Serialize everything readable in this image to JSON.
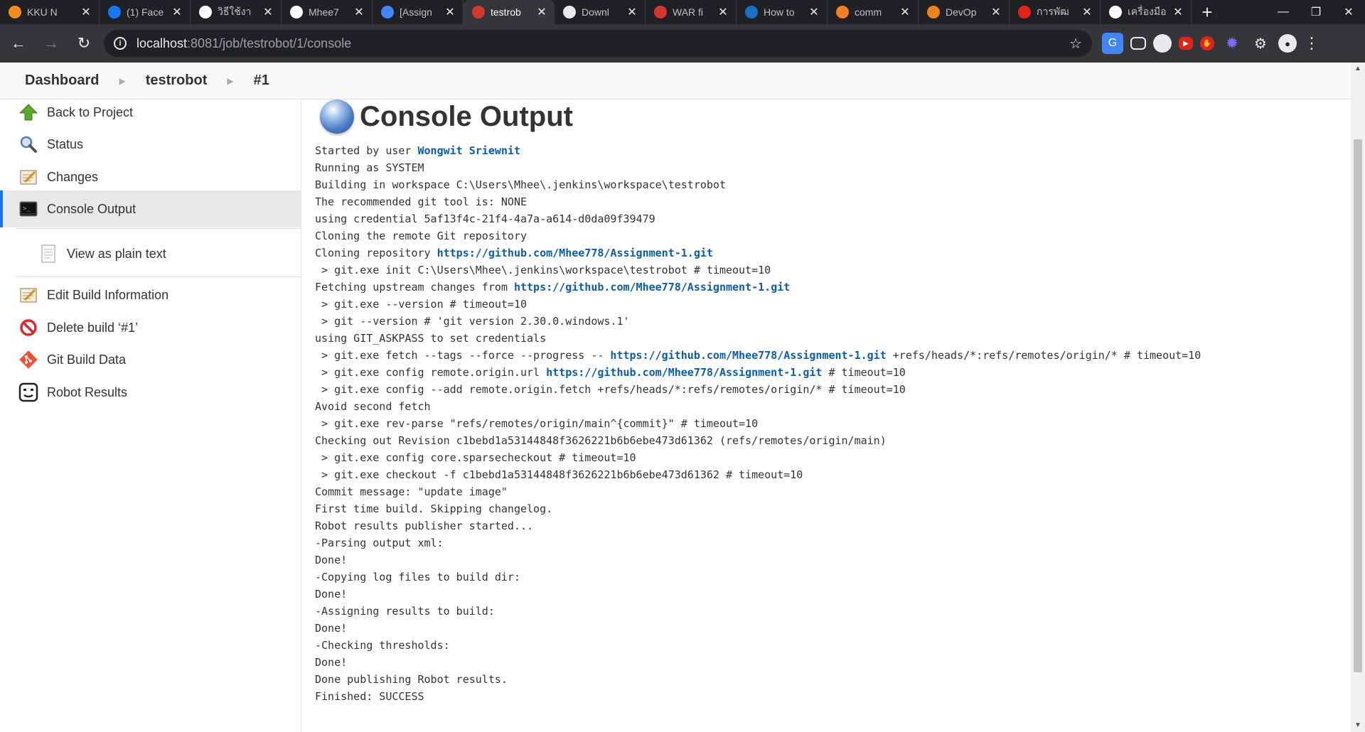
{
  "browser": {
    "tabs": [
      {
        "title": "KKU N",
        "icon": "kku-icon",
        "color": "#f28b22"
      },
      {
        "title": "(1) Face",
        "icon": "facebook-icon",
        "color": "#1877f2"
      },
      {
        "title": "วิธีใช้งา",
        "icon": "github-icon",
        "color": "#ffffff"
      },
      {
        "title": "Mhee7",
        "icon": "github-icon",
        "color": "#ffffff"
      },
      {
        "title": "[Assign",
        "icon": "classroom-icon",
        "color": "#4285f4"
      },
      {
        "title": "testrob",
        "icon": "jenkins-icon",
        "color": "#d33833",
        "active": true
      },
      {
        "title": "Downl",
        "icon": "download-icon",
        "color": "#e8eaed"
      },
      {
        "title": "WAR fi",
        "icon": "jenkins-icon",
        "color": "#d33833"
      },
      {
        "title": "How to",
        "icon": "edureka-icon",
        "color": "#1c6ec7"
      },
      {
        "title": "comm",
        "icon": "stackoverflow-icon",
        "color": "#f48024"
      },
      {
        "title": "DevOp",
        "icon": "devops-icon",
        "color": "#f0821e"
      },
      {
        "title": "การพัฒ",
        "icon": "slide-icon",
        "color": "#e2231a"
      },
      {
        "title": "เครื่องมือ",
        "icon": "google-icon",
        "color": "#ffffff"
      }
    ],
    "url_host": "localhost",
    "url_path": ":8081/job/testrobot/1/console"
  },
  "breadcrumbs": [
    "Dashboard",
    "testrobot",
    "#1"
  ],
  "sidebar": {
    "items": [
      {
        "label": "Back to Project",
        "icon": "up-arrow-icon"
      },
      {
        "label": "Status",
        "icon": "magnifier-icon"
      },
      {
        "label": "Changes",
        "icon": "notepad-icon"
      },
      {
        "label": "Console Output",
        "icon": "terminal-icon",
        "active": true
      },
      {
        "label": "View as plain text",
        "icon": "document-icon",
        "sub": true
      },
      {
        "label": "Edit Build Information",
        "icon": "notepad-icon"
      },
      {
        "label": "Delete build ‘#1’",
        "icon": "no-entry-icon"
      },
      {
        "label": "Git Build Data",
        "icon": "git-icon"
      },
      {
        "label": "Robot Results",
        "icon": "robot-icon"
      }
    ]
  },
  "main": {
    "title": "Console Output",
    "console_lines": [
      [
        {
          "t": "Started by user "
        },
        {
          "t": "Wongwit Sriewnit",
          "link": true
        }
      ],
      [
        {
          "t": "Running as SYSTEM"
        }
      ],
      [
        {
          "t": "Building in workspace C:\\Users\\Mhee\\.jenkins\\workspace\\testrobot"
        }
      ],
      [
        {
          "t": "The recommended git tool is: NONE"
        }
      ],
      [
        {
          "t": "using credential 5af13f4c-21f4-4a7a-a614-d0da09f39479"
        }
      ],
      [
        {
          "t": "Cloning the remote Git repository"
        }
      ],
      [
        {
          "t": "Cloning repository "
        },
        {
          "t": "https://github.com/Mhee778/Assignment-1.git",
          "link": true
        }
      ],
      [
        {
          "t": " > git.exe init C:\\Users\\Mhee\\.jenkins\\workspace\\testrobot # timeout=10"
        }
      ],
      [
        {
          "t": "Fetching upstream changes from "
        },
        {
          "t": "https://github.com/Mhee778/Assignment-1.git",
          "link": true
        }
      ],
      [
        {
          "t": " > git.exe --version # timeout=10"
        }
      ],
      [
        {
          "t": " > git --version # 'git version 2.30.0.windows.1'"
        }
      ],
      [
        {
          "t": "using GIT_ASKPASS to set credentials"
        }
      ],
      [
        {
          "t": " > git.exe fetch --tags --force --progress -- "
        },
        {
          "t": "https://github.com/Mhee778/Assignment-1.git",
          "link": true
        },
        {
          "t": " +refs/heads/*:refs/remotes/origin/* # timeout=10"
        }
      ],
      [
        {
          "t": " > git.exe config remote.origin.url "
        },
        {
          "t": "https://github.com/Mhee778/Assignment-1.git",
          "link": true
        },
        {
          "t": " # timeout=10"
        }
      ],
      [
        {
          "t": " > git.exe config --add remote.origin.fetch +refs/heads/*:refs/remotes/origin/* # timeout=10"
        }
      ],
      [
        {
          "t": "Avoid second fetch"
        }
      ],
      [
        {
          "t": " > git.exe rev-parse \"refs/remotes/origin/main^{commit}\" # timeout=10"
        }
      ],
      [
        {
          "t": "Checking out Revision c1bebd1a53144848f3626221b6b6ebe473d61362 (refs/remotes/origin/main)"
        }
      ],
      [
        {
          "t": " > git.exe config core.sparsecheckout # timeout=10"
        }
      ],
      [
        {
          "t": " > git.exe checkout -f c1bebd1a53144848f3626221b6b6ebe473d61362 # timeout=10"
        }
      ],
      [
        {
          "t": "Commit message: \"update image\""
        }
      ],
      [
        {
          "t": "First time build. Skipping changelog."
        }
      ],
      [
        {
          "t": "Robot results publisher started..."
        }
      ],
      [
        {
          "t": "-Parsing output xml:"
        }
      ],
      [
        {
          "t": "Done!"
        }
      ],
      [
        {
          "t": "-Copying log files to build dir:"
        }
      ],
      [
        {
          "t": "Done!"
        }
      ],
      [
        {
          "t": "-Assigning results to build:"
        }
      ],
      [
        {
          "t": "Done!"
        }
      ],
      [
        {
          "t": "-Checking thresholds:"
        }
      ],
      [
        {
          "t": "Done!"
        }
      ],
      [
        {
          "t": "Done publishing Robot results."
        }
      ],
      [
        {
          "t": "Finished: SUCCESS"
        }
      ]
    ]
  }
}
